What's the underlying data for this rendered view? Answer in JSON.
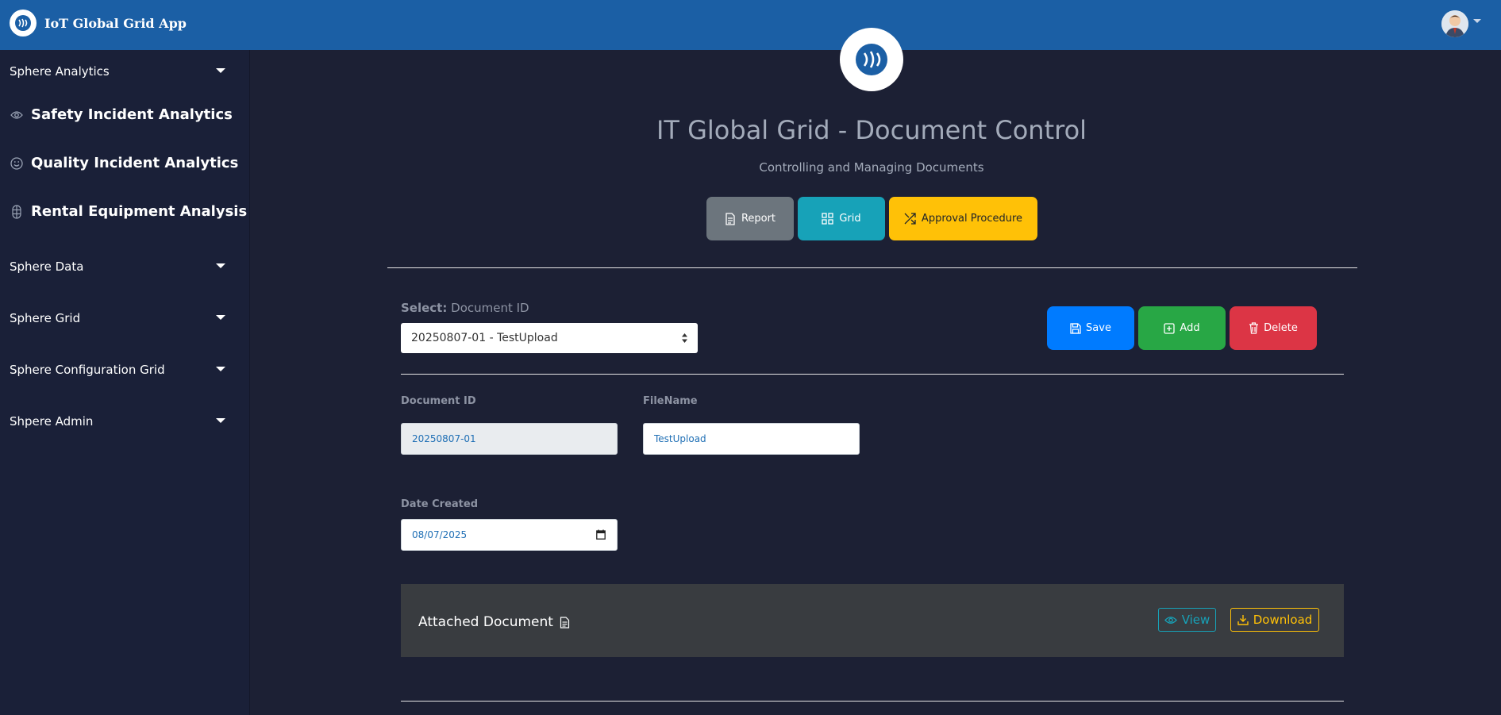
{
  "app": {
    "title": "IoT Global Grid App"
  },
  "sidebar": {
    "sections": [
      {
        "label": "Sphere Analytics"
      },
      {
        "label": "Sphere Data"
      },
      {
        "label": "Sphere Grid"
      },
      {
        "label": "Sphere Configuration Grid"
      },
      {
        "label": "Shpere Admin"
      }
    ],
    "links": [
      {
        "label": "Safety Incident Analytics",
        "icon": "eye-icon"
      },
      {
        "label": "Quality Incident Analytics",
        "icon": "smile-icon"
      },
      {
        "label": "Rental Equipment Analysis",
        "icon": "figma-icon"
      }
    ]
  },
  "header": {
    "title": "IT Global Grid - Document Control",
    "subtitle": "Controlling and Managing Documents"
  },
  "toolbar": {
    "report_label": "Report",
    "grid_label": "Grid",
    "approval_label": "Approval Procedure"
  },
  "select": {
    "label_bold": "Select:",
    "label_rest": "Document ID",
    "value": "20250807-01 - TestUpload"
  },
  "actions": {
    "save": "Save",
    "add": "Add",
    "delete": "Delete"
  },
  "form": {
    "document_id_label": "Document ID",
    "document_id_value": "20250807-01",
    "filename_label": "FileName",
    "filename_value": "TestUpload",
    "date_created_label": "Date Created",
    "date_created_value": "08/07/2025"
  },
  "attachment": {
    "title": "Attached Document",
    "view_label": "View",
    "download_label": "Download"
  },
  "colors": {
    "topbar": "#1b5fa5",
    "sidebar": "#1a2038",
    "content": "#1c2034",
    "report": "#6c757d",
    "grid": "#17a2b8",
    "approval": "#ffc107",
    "save": "#007bff",
    "add": "#28a745",
    "delete": "#dc3545"
  }
}
